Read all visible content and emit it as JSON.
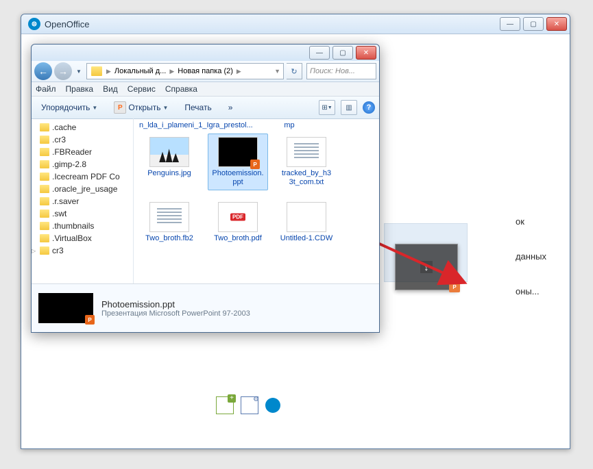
{
  "oo_window": {
    "title": "OpenOffice",
    "links": {
      "link1": "ок",
      "link2": "данных",
      "link3": "оны..."
    }
  },
  "explorer": {
    "nav": {
      "crumb1": "Локальный д...",
      "crumb2": "Новая папка (2)",
      "search_placeholder": "Поиск: Нов..."
    },
    "menu": {
      "file": "Файл",
      "edit": "Правка",
      "view": "Вид",
      "service": "Сервис",
      "help": "Справка"
    },
    "toolbar": {
      "organize": "Упорядочить",
      "open": "Открыть",
      "print": "Печать",
      "more": "»",
      "app_letter": "P",
      "help": "?"
    },
    "sidebar": [
      ".cache",
      ".cr3",
      ".FBReader",
      ".gimp-2.8",
      ".Icecream PDF Co",
      ".oracle_jre_usage",
      ".r.saver",
      ".swt",
      ".thumbnails",
      ".VirtualBox",
      "cr3"
    ],
    "files_top": {
      "f1": "n_lda_i_plameni_1_Igra_prestol...",
      "f2": "mp"
    },
    "files": [
      {
        "name": "Penguins.jpg",
        "type": "img"
      },
      {
        "name": "Photoemission.ppt",
        "type": "ppt",
        "selected": true
      },
      {
        "name": "tracked_by_h33t_com.txt",
        "type": "txt"
      },
      {
        "name": "Two_broth.fb2",
        "type": "txt"
      },
      {
        "name": "Two_broth.pdf",
        "type": "pdf"
      },
      {
        "name": "Untitled-1.CDW",
        "type": "blank"
      }
    ],
    "details": {
      "name": "Photoemission.ppt",
      "type": "Презентация Microsoft PowerPoint 97-2003"
    }
  }
}
